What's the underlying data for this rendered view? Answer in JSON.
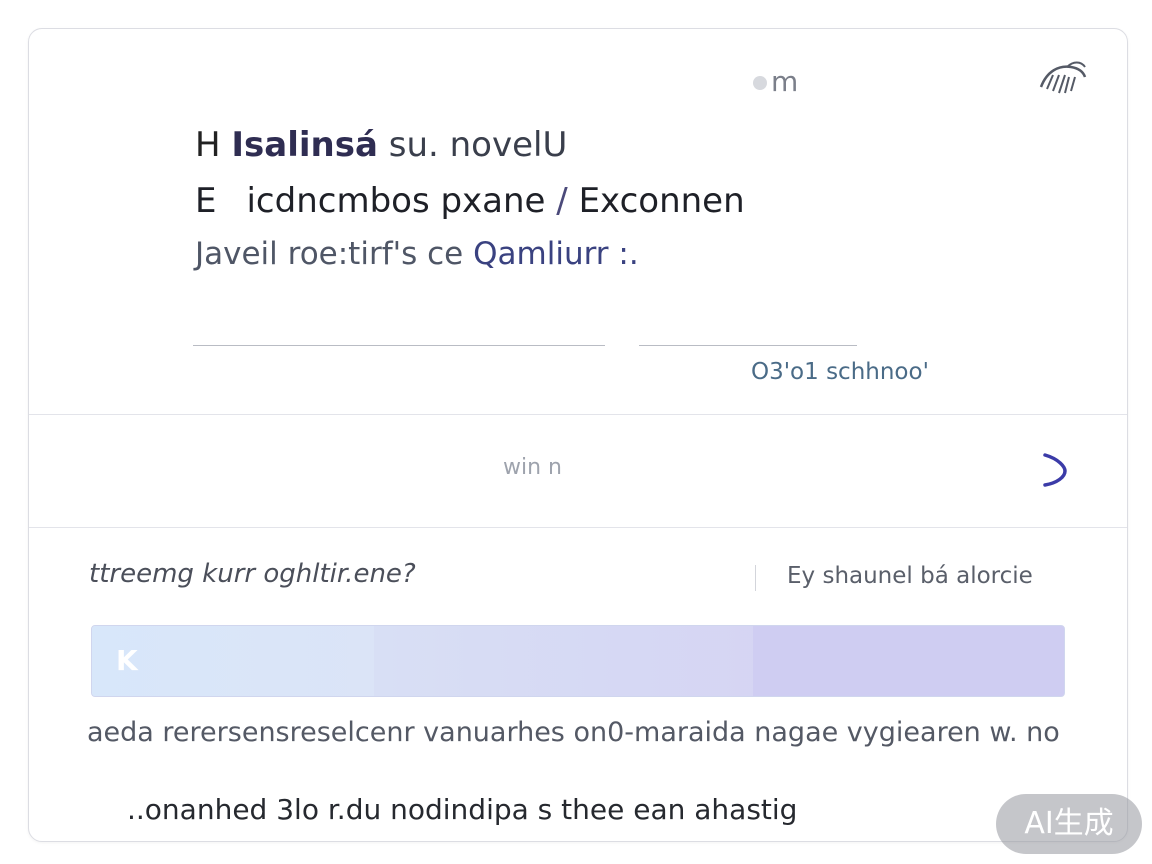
{
  "header": {
    "indicator_text": "m",
    "corner_icon": "avatar-sketch-icon"
  },
  "headline": {
    "line1_prefix": "H",
    "line1_accent": "Isalinsá",
    "line1_rest": "su. novelU",
    "line2_prefix": "E",
    "line2_main": "icdncmbos pxane",
    "line2_slash": "/",
    "line2_tail": "Exconnen",
    "line3_main": "Javeil roe:tirf's ce",
    "line3_accent": "Qamliurr :."
  },
  "small_link": "O3'o1 schhnoo'",
  "nav": {
    "label": "win n",
    "chevron_icon": "chevron-right-icon",
    "accent_color": "#3b3ba8"
  },
  "question": {
    "text": "ttreemg kurr oghltir.ene?",
    "side_note": "Ey shaunel bá alorcie"
  },
  "progress": {
    "mark": "K",
    "segments": [
      0.29,
      0.39,
      0.32
    ]
  },
  "caption": "aeda rerersensreselcenr vanuarhes on0-maraida nagae vygiearen w. no",
  "footer_text": "..onanhed 3lo r.du nodindipa s thee ean ahastig",
  "badge": "AI生成"
}
